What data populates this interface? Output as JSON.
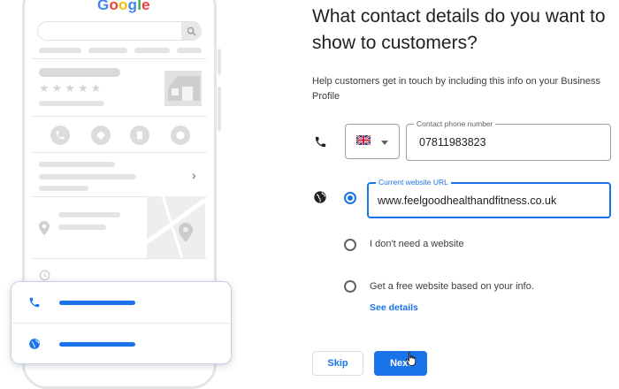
{
  "illustration": {
    "logo_letters": [
      "G",
      "o",
      "o",
      "g",
      "l",
      "e"
    ],
    "stars": "★★★★★",
    "chevron": "›"
  },
  "form": {
    "heading": "What contact details do you want to show to customers?",
    "help_text": "Help customers get in touch by including this info on your Business Profile",
    "phone": {
      "label": "Contact phone number",
      "value": "07811983823"
    },
    "website": {
      "label": "Current website URL",
      "value": "www.feelgoodhealthandfitness.co.uk"
    },
    "options": {
      "no_website": "I don't need a website",
      "free_website": "Get a free website based on your info."
    },
    "see_details": "See details"
  },
  "buttons": {
    "skip": "Skip",
    "next": "Next"
  },
  "colors": {
    "accent": "#1a73e8",
    "text": "#202124",
    "muted": "#5f6368"
  }
}
